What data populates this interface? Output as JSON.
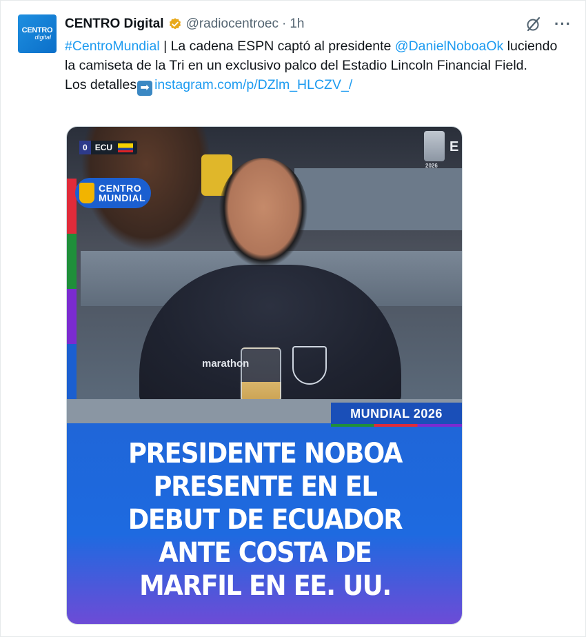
{
  "tweet": {
    "avatar": {
      "line1": "CENTRO",
      "line2": "digital"
    },
    "display_name": "CENTRO Digital",
    "handle": "@radiocentroec",
    "separator": "·",
    "time": "1h",
    "text": {
      "hashtag": "#CentroMundial",
      "part1": " | La cadena ESPN captó al presidente ",
      "mention": "@DanielNoboaOk",
      "part2": " luciendo la camiseta de la Tri en un exclusivo palco del Estadio Lincoln Financial Field.",
      "details_label": "Los detalles",
      "arrow_emoji": "➡",
      "link": "instagram.com/p/DZlm_HLCZV_/"
    },
    "icons": [
      "verified-badge-icon",
      "grok-icon",
      "more-icon"
    ],
    "colors": {
      "link": "#1d9bf0",
      "secondary": "#536471",
      "verified": "#e8a91b"
    }
  },
  "media": {
    "scorebug": {
      "score": "0",
      "team": "ECU"
    },
    "centro_mundial_logo": {
      "line1": "CENTRO",
      "line2": "MUNDIAL"
    },
    "wc_logo_text": "2026",
    "tag": "MUNDIAL 2026",
    "shirt_brand": "marathon",
    "headline": [
      "PRESIDENTE NOBOA",
      "PRESENTE EN EL",
      "DEBUT DE ECUADOR",
      "ANTE COSTA DE",
      "MARFIL EN EE. UU."
    ]
  }
}
